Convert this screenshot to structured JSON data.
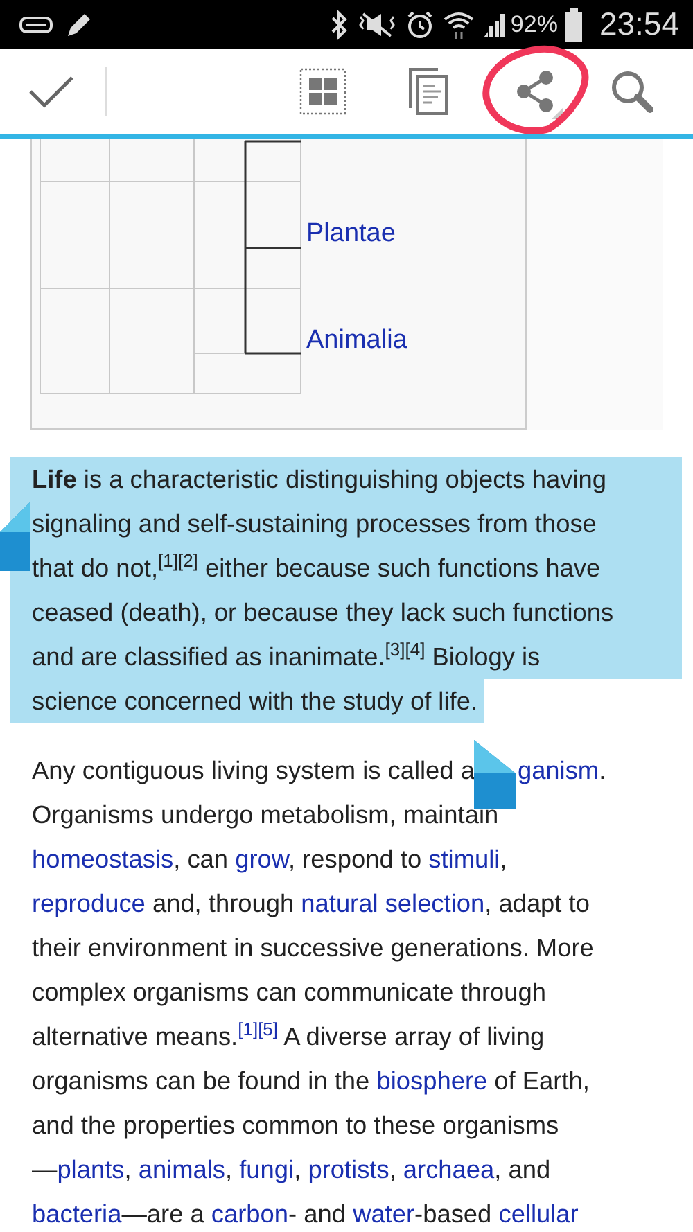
{
  "status_bar": {
    "battery": "92%",
    "time": "23:54"
  },
  "toolbar": {
    "actions": [
      {
        "kind": "done"
      },
      {
        "kind": "select_all"
      },
      {
        "kind": "copy"
      },
      {
        "kind": "share",
        "circled": true
      },
      {
        "kind": "search"
      }
    ]
  },
  "diagram": {
    "labels": [
      "Plantae",
      "Animalia"
    ]
  },
  "paragraphs": [
    {
      "selected": true,
      "lines": [
        [
          {
            "kind": "bold",
            "text": "Life"
          },
          {
            "kind": "text",
            "text": " is a characteristic distinguishing objects having"
          }
        ],
        [
          {
            "kind": "text",
            "text": "signaling and self-sustaining processes from those"
          }
        ],
        [
          {
            "kind": "text",
            "text": "that do not,"
          },
          {
            "kind": "ref",
            "text": "[1][2]"
          },
          {
            "kind": "text",
            "text": " either because such functions have"
          }
        ],
        [
          {
            "kind": "text",
            "text": "ceased (death), or because they lack such functions"
          }
        ],
        [
          {
            "kind": "text",
            "text": "and are classified as inanimate."
          },
          {
            "kind": "ref",
            "text": "[3][4]"
          },
          {
            "kind": "text",
            "text": " Biology is"
          }
        ],
        [
          {
            "kind": "text",
            "text": "science concerned with the study of life."
          }
        ]
      ]
    },
    {
      "selected": false,
      "lines": [
        [
          {
            "kind": "text",
            "text": "Any contiguous living system is called a"
          },
          {
            "kind": "handle"
          },
          {
            "kind": "link",
            "text": "ganism"
          },
          {
            "kind": "text",
            "text": "."
          }
        ],
        [
          {
            "kind": "text",
            "text": "Organisms undergo metabolism, maintain"
          }
        ],
        [
          {
            "kind": "link",
            "text": "homeostasis"
          },
          {
            "kind": "text",
            "text": ", can "
          },
          {
            "kind": "link",
            "text": "grow"
          },
          {
            "kind": "text",
            "text": ", respond to "
          },
          {
            "kind": "link",
            "text": "stimuli"
          },
          {
            "kind": "text",
            "text": ","
          }
        ],
        [
          {
            "kind": "link",
            "text": "reproduce"
          },
          {
            "kind": "text",
            "text": " and, through "
          },
          {
            "kind": "link",
            "text": "natural selection"
          },
          {
            "kind": "text",
            "text": ", adapt to"
          }
        ],
        [
          {
            "kind": "text",
            "text": "their environment in successive generations. More"
          }
        ],
        [
          {
            "kind": "text",
            "text": "complex organisms can communicate through"
          }
        ],
        [
          {
            "kind": "text",
            "text": "alternative means."
          },
          {
            "kind": "ref",
            "text": "[1][5]"
          },
          {
            "kind": "text",
            "text": " A diverse array of living"
          }
        ],
        [
          {
            "kind": "text",
            "text": "organisms can be found in the "
          },
          {
            "kind": "link",
            "text": "biosphere"
          },
          {
            "kind": "text",
            "text": " of Earth,"
          }
        ],
        [
          {
            "kind": "text",
            "text": "and the properties common to these organisms"
          }
        ],
        [
          {
            "kind": "text",
            "text": "—"
          },
          {
            "kind": "link",
            "text": "plants"
          },
          {
            "kind": "text",
            "text": ", "
          },
          {
            "kind": "link",
            "text": "animals"
          },
          {
            "kind": "text",
            "text": ", "
          },
          {
            "kind": "link",
            "text": "fungi"
          },
          {
            "kind": "text",
            "text": ", "
          },
          {
            "kind": "link",
            "text": "protists"
          },
          {
            "kind": "text",
            "text": ", "
          },
          {
            "kind": "link",
            "text": "archaea"
          },
          {
            "kind": "text",
            "text": ", and"
          }
        ],
        [
          {
            "kind": "link",
            "text": "bacteria"
          },
          {
            "kind": "text",
            "text": "—are a "
          },
          {
            "kind": "link",
            "text": "carbon"
          },
          {
            "kind": "text",
            "text": "- and "
          },
          {
            "kind": "link",
            "text": "water"
          },
          {
            "kind": "text",
            "text": "-based "
          },
          {
            "kind": "link",
            "text": "cellular"
          }
        ]
      ]
    }
  ]
}
